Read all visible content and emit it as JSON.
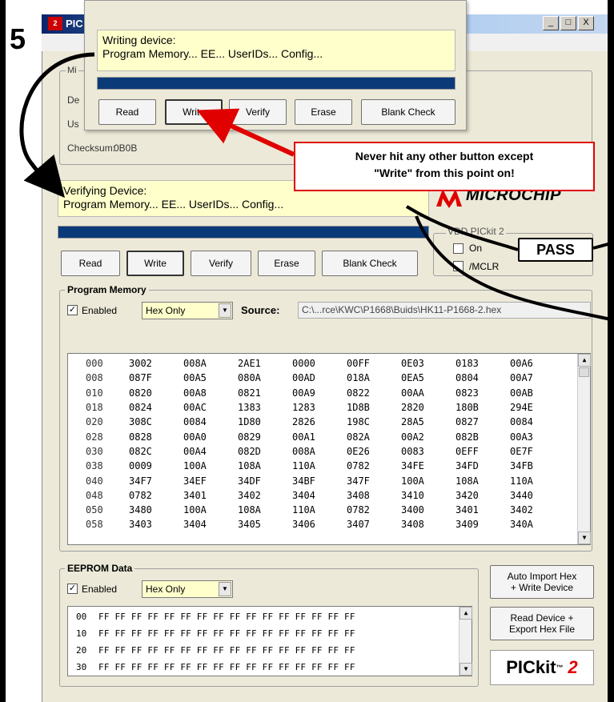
{
  "step_number": "5",
  "window": {
    "title": "PIC",
    "controls": [
      "_",
      "□",
      "X"
    ]
  },
  "device_config": {
    "checksum_label": "Checksum:",
    "checksum_value": "0B0B"
  },
  "overlay": {
    "status_line1": "Writing device:",
    "status_line2": "Program Memory... EE... UserIDs... Config...",
    "buttons": [
      "Read",
      "Write",
      "Verify",
      "Erase",
      "Blank Check"
    ]
  },
  "main_status": {
    "line1": "Verifying Device:",
    "line2": "Program Memory... EE... UserIDs... Config..."
  },
  "main_buttons": [
    "Read",
    "Write",
    "Verify",
    "Erase",
    "Blank Check"
  ],
  "callout_text_line1": "Never hit any other button except",
  "callout_text_line2": "\"Write\" from this point on!",
  "pass_label": "PASS",
  "brand": "MICROCHIP",
  "vdd": {
    "label": "VDD PICkit 2",
    "on_label": "On",
    "mclr_label": "/MCLR"
  },
  "program_memory": {
    "title": "Program Memory",
    "enabled_label": "Enabled",
    "enabled_checked": "✓",
    "mode": "Hex Only",
    "source_label": "Source:",
    "source_path": "C:\\...rce\\KWC\\P1668\\Buids\\HK11-P1668-2.hex",
    "rows": [
      {
        "addr": "000",
        "cells": [
          "3002",
          "008A",
          "2AE1",
          "0000",
          "00FF",
          "0E03",
          "0183",
          "00A6"
        ]
      },
      {
        "addr": "008",
        "cells": [
          "087F",
          "00A5",
          "080A",
          "00AD",
          "018A",
          "0EA5",
          "0804",
          "00A7"
        ]
      },
      {
        "addr": "010",
        "cells": [
          "0820",
          "00A8",
          "0821",
          "00A9",
          "0822",
          "00AA",
          "0823",
          "00AB"
        ]
      },
      {
        "addr": "018",
        "cells": [
          "0824",
          "00AC",
          "1383",
          "1283",
          "1D8B",
          "2820",
          "180B",
          "294E"
        ]
      },
      {
        "addr": "020",
        "cells": [
          "308C",
          "0084",
          "1D80",
          "2826",
          "198C",
          "28A5",
          "0827",
          "0084"
        ]
      },
      {
        "addr": "028",
        "cells": [
          "0828",
          "00A0",
          "0829",
          "00A1",
          "082A",
          "00A2",
          "082B",
          "00A3"
        ]
      },
      {
        "addr": "030",
        "cells": [
          "082C",
          "00A4",
          "082D",
          "008A",
          "0E26",
          "0083",
          "0EFF",
          "0E7F"
        ]
      },
      {
        "addr": "038",
        "cells": [
          "0009",
          "100A",
          "108A",
          "110A",
          "0782",
          "34FE",
          "34FD",
          "34FB"
        ]
      },
      {
        "addr": "040",
        "cells": [
          "34F7",
          "34EF",
          "34DF",
          "34BF",
          "347F",
          "100A",
          "108A",
          "110A"
        ]
      },
      {
        "addr": "048",
        "cells": [
          "0782",
          "3401",
          "3402",
          "3404",
          "3408",
          "3410",
          "3420",
          "3440"
        ]
      },
      {
        "addr": "050",
        "cells": [
          "3480",
          "100A",
          "108A",
          "110A",
          "0782",
          "3400",
          "3401",
          "3402"
        ]
      },
      {
        "addr": "058",
        "cells": [
          "3403",
          "3404",
          "3405",
          "3406",
          "3407",
          "3408",
          "3409",
          "340A"
        ]
      }
    ]
  },
  "eeprom": {
    "title": "EEPROM Data",
    "enabled_label": "Enabled",
    "enabled_checked": "✓",
    "mode": "Hex Only",
    "rows": [
      {
        "addr": "00",
        "data": "FF FF FF FF FF FF FF FF FF FF FF FF FF FF FF FF"
      },
      {
        "addr": "10",
        "data": "FF FF FF FF FF FF FF FF FF FF FF FF FF FF FF FF"
      },
      {
        "addr": "20",
        "data": "FF FF FF FF FF FF FF FF FF FF FF FF FF FF FF FF"
      },
      {
        "addr": "30",
        "data": "FF FF FF FF FF FF FF FF FF FF FF FF FF FF FF FF"
      }
    ]
  },
  "side_buttons": {
    "auto_import_line1": "Auto Import Hex",
    "auto_import_line2": "+ Write Device",
    "read_export_line1": "Read Device +",
    "read_export_line2": "Export Hex File"
  },
  "pickit_logo": {
    "text": "PICkit",
    "tm": "™",
    "number": "2"
  },
  "colors": {
    "status_bg": "#ffffcc",
    "progress": "#0b3a78",
    "callout_border": "#e00000",
    "window_bg": "#ece9d8"
  }
}
